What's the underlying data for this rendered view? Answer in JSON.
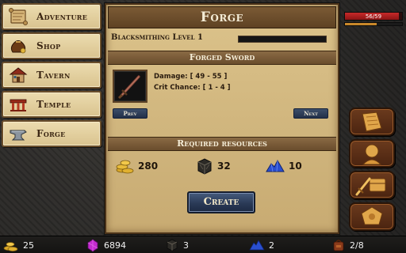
{
  "nav": {
    "items": [
      {
        "label": "Adventure",
        "icon": "scroll-map-icon"
      },
      {
        "label": "Shop",
        "icon": "coin-bag-icon"
      },
      {
        "label": "Tavern",
        "icon": "tavern-house-icon"
      },
      {
        "label": "Temple",
        "icon": "temple-icon"
      },
      {
        "label": "Forge",
        "icon": "anvil-icon"
      }
    ]
  },
  "forge": {
    "title": "Forge",
    "level_label": "Blacksmithing Level 1",
    "level_progress": 0,
    "item_name": "Forged Sword",
    "item_icon": "sword-icon",
    "damage": "Damage: [ 49 - 55 ]",
    "crit": "Crit Chance: [ 1 - 4 ]",
    "prev_label": "Prev",
    "next_label": "Next",
    "resources_title": "Required resources",
    "resources": [
      {
        "icon": "gold-coins-icon",
        "value": "280"
      },
      {
        "icon": "wood-crate-icon",
        "value": "32"
      },
      {
        "icon": "blue-crystal-icon",
        "value": "10"
      }
    ],
    "create_label": "Create"
  },
  "player": {
    "hp_text": "56/59",
    "hp_fraction": 0.949,
    "xp_fraction": 0.55
  },
  "side_buttons": [
    {
      "icon": "map-icon"
    },
    {
      "icon": "character-head-icon"
    },
    {
      "icon": "inventory-chest-sword-icon"
    },
    {
      "icon": "sigil-icon"
    }
  ],
  "bottom_bar": [
    {
      "icon": "gold-coins-icon",
      "value": "25"
    },
    {
      "icon": "pink-gem-icon",
      "value": "6894"
    },
    {
      "icon": "wood-crate-icon",
      "value": "3"
    },
    {
      "icon": "blue-crystal-icon",
      "value": "2"
    },
    {
      "icon": "backpack-icon",
      "value": "2/8"
    }
  ],
  "colors": {
    "parchment": "#d6bd86",
    "title_wood": "#6a4b29",
    "button_blue": "#2a3a57",
    "hp_red": "#c72a2a"
  }
}
